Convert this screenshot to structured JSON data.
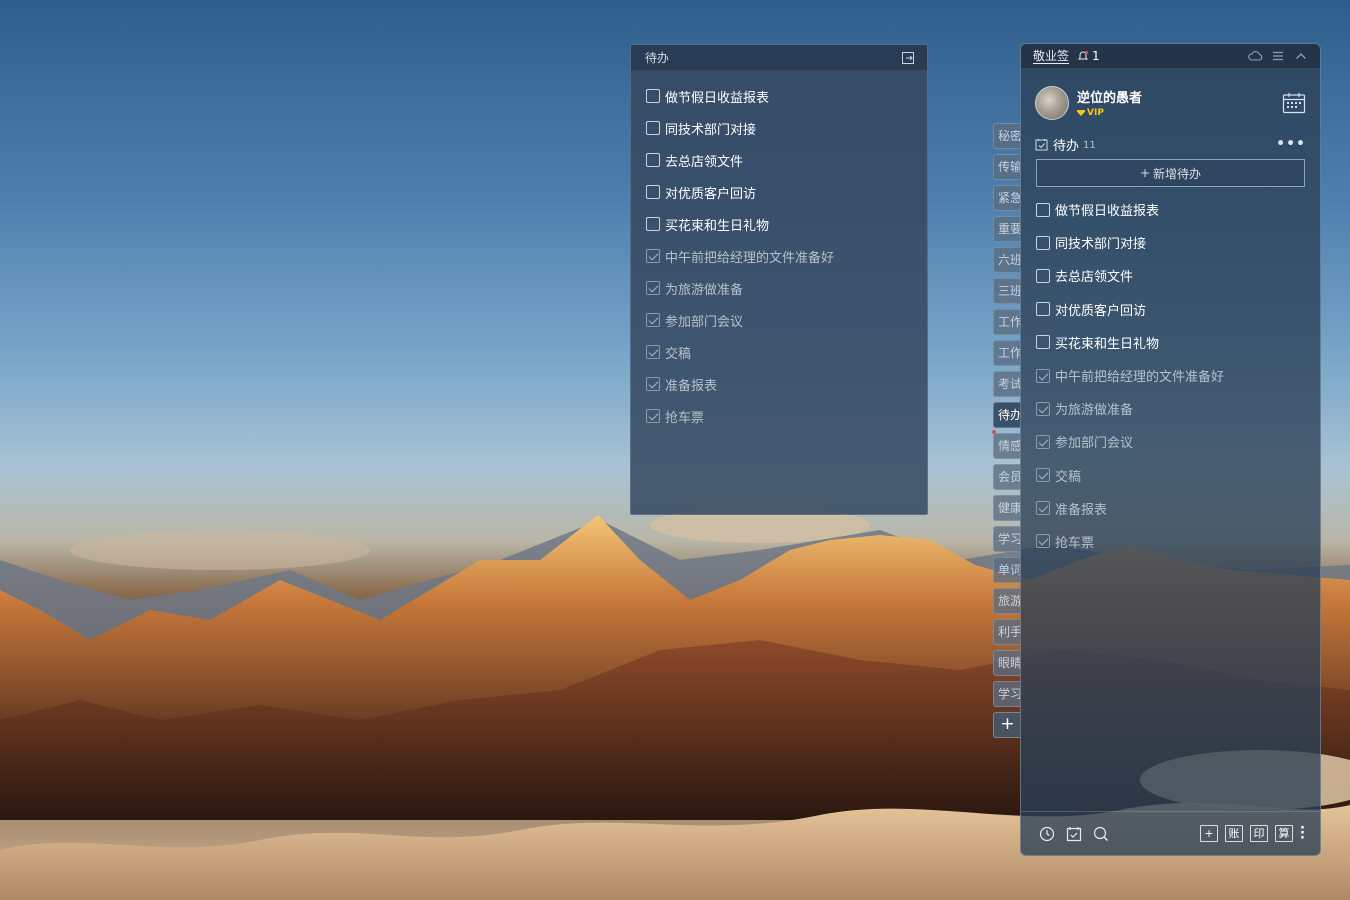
{
  "widget": {
    "title": "待办",
    "items": [
      {
        "label": "做节假日收益报表",
        "done": false
      },
      {
        "label": "同技术部门对接",
        "done": false
      },
      {
        "label": "去总店领文件",
        "done": false
      },
      {
        "label": "对优质客户回访",
        "done": false
      },
      {
        "label": "买花束和生日礼物",
        "done": false
      },
      {
        "label": "中午前把给经理的文件准备好",
        "done": true
      },
      {
        "label": "为旅游做准备",
        "done": true
      },
      {
        "label": "参加部门会议",
        "done": true
      },
      {
        "label": "交稿",
        "done": true
      },
      {
        "label": "准备报表",
        "done": true
      },
      {
        "label": "抢车票",
        "done": true
      }
    ]
  },
  "tabs": {
    "items": [
      "秘密",
      "传输",
      "紧急",
      "重要",
      "六班",
      "三班",
      "工作",
      "工作",
      "考试",
      "待办",
      "情感",
      "会员",
      "健康",
      "学习",
      "单词",
      "旅游",
      "利手",
      "眼睛",
      "学习"
    ],
    "active_index": 9,
    "add_label": "+"
  },
  "panel": {
    "app_title": "敬业签",
    "notification_count": "1",
    "user": {
      "name": "逆位的愚者",
      "badge": "VIP"
    },
    "section": {
      "title": "待办",
      "count": "11",
      "more": "•••"
    },
    "add_button": {
      "plus": "+",
      "label": "新增待办"
    },
    "items": [
      {
        "label": "做节假日收益报表",
        "done": false
      },
      {
        "label": "同技术部门对接",
        "done": false
      },
      {
        "label": "去总店领文件",
        "done": false
      },
      {
        "label": "对优质客户回访",
        "done": false
      },
      {
        "label": "买花束和生日礼物",
        "done": false
      },
      {
        "label": "中午前把给经理的文件准备好",
        "done": true
      },
      {
        "label": "为旅游做准备",
        "done": true
      },
      {
        "label": "参加部门会议",
        "done": true
      },
      {
        "label": "交稿",
        "done": true
      },
      {
        "label": "准备报表",
        "done": true
      },
      {
        "label": "抢车票",
        "done": true
      }
    ],
    "bottom": {
      "left_icons": [
        "clock-icon",
        "checklist-icon",
        "search-icon"
      ],
      "buttons": [
        "+",
        "账",
        "印",
        "算"
      ]
    }
  },
  "colors": {
    "panel_bg": "#2c4056",
    "vip": "#f5c518",
    "alert_dot": "#e04b4b"
  }
}
